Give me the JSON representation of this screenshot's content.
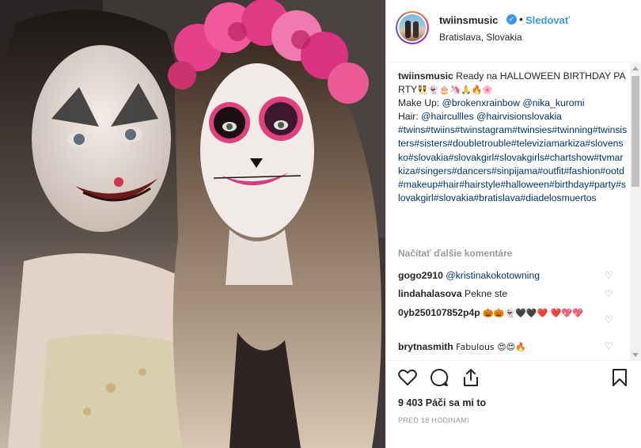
{
  "post": {
    "username": "twiinsmusic",
    "verified_mark": "✓",
    "separator": "•",
    "follow_label": "Sledovať",
    "location": "Bratislava, Slovakia"
  },
  "caption": {
    "username": "twiinsmusic",
    "text_1": " Ready na HALLOWEEN BIRTHDAY PARTY",
    "emojis_1": "👯👻🎂🦄🙏🔥🌸",
    "makeup_label": "Make Up: ",
    "makeup_handle_1": "@brokenxrainbow",
    "makeup_handle_2": "@nika_kuromi",
    "hair_label": "Hair: ",
    "hair_handle_1": "@haircullles",
    "hair_handle_2": "@hairvisionslovakia",
    "hashtags": "#twins#twiins#twinstagram#twinsies#twinning#twinsisters#sisters#doubletrouble#televiziamarkiza#slovensko#slovakia#slovakgirl#slovakgirls#chartshow#tvmarkiza#singers#dancers#sinpijama#outfit#fashion#ootd#makeup#hair#hairstyle#halloween#birthday#party#slovakgirl#slovakia#bratislava#diadelosmuertos"
  },
  "load_more_label": "Načítať ďalšie komentáre",
  "comments": [
    {
      "username": "gogo2910",
      "text": "@kristinakokotowning",
      "is_link": true
    },
    {
      "username": "lindahalasova",
      "text": "Pekne ste",
      "is_link": false
    },
    {
      "username": "0yb250107852p4p",
      "text": "🎃🎃👻🖤🖤❤️ ❤️💖💖",
      "is_link": false
    },
    {
      "username": "brytnasmith",
      "text": "Fabulous 😍😍🔥",
      "is_link": false
    }
  ],
  "comment_like_glyph": "♡",
  "likes_text": "9 403 Páči sa mi to",
  "timestamp": "PRED 18 HODINAMI",
  "colors": {
    "link": "#003569",
    "follow": "#3897f0",
    "muted": "#999999"
  },
  "icons": {
    "like": "heart-outline-icon",
    "comment": "speech-bubble-icon",
    "share": "share-upload-icon",
    "save": "bookmark-icon"
  }
}
